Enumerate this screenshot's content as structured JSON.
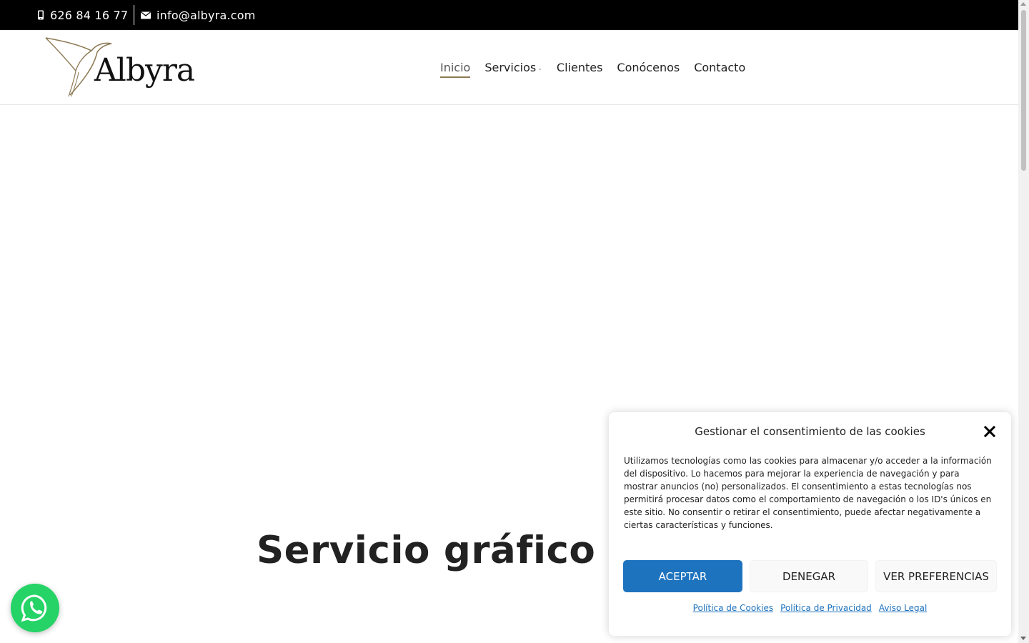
{
  "topbar": {
    "phone": "626 84 16 77",
    "phone_icon": "mobile-phone-icon",
    "email": "info@albyra.com",
    "email_icon": "envelope-icon"
  },
  "header": {
    "logo_text": "Albyra",
    "logo_icon": "hummingbird-logo-icon",
    "nav": [
      {
        "label": "Inicio",
        "active": true
      },
      {
        "label": "Servicios",
        "has_dropdown": true
      },
      {
        "label": "Clientes"
      },
      {
        "label": "Conócenos"
      },
      {
        "label": "Contacto"
      }
    ]
  },
  "hero": {
    "title": "Servicio gráfico i"
  },
  "whatsapp": {
    "icon": "whatsapp-icon",
    "color": "#25d366"
  },
  "cookie": {
    "title": "Gestionar el consentimiento de las cookies",
    "message": "Utilizamos tecnologías como las cookies para almacenar y/o acceder a la información del dispositivo. Lo hacemos para mejorar la experiencia de navegación y para mostrar anuncios (no) personalizados. El consentimiento a estas tecnologías nos permitirá procesar datos como el comportamiento de navegación o los ID's únicos en este sitio. No consentir o retirar el consentimiento, puede afectar negativamente a ciertas características y funciones.",
    "accept_label": "ACEPTAR",
    "deny_label": "DENEGAR",
    "prefs_label": "VER PREFERENCIAS",
    "links": [
      "Política de Cookies",
      "Política de Privacidad",
      "Aviso Legal"
    ],
    "accent_color": "#1e73be"
  },
  "colors": {
    "topbar_bg": "#000000",
    "nav_active_underline": "#8d7a55",
    "logo_gold": "#8d7a55"
  }
}
